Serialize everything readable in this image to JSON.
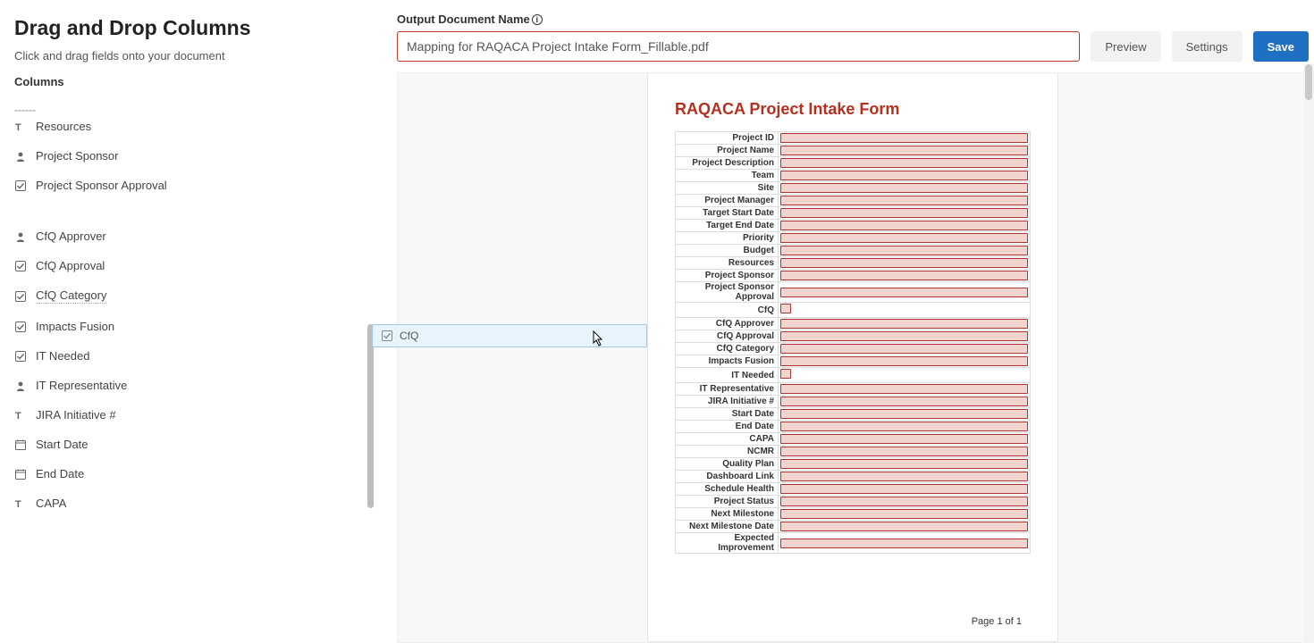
{
  "sidebar": {
    "title": "Drag and Drop Columns",
    "subtitle": "Click and drag fields onto your document",
    "columns_heading": "Columns",
    "partial_top": "------",
    "items": [
      {
        "icon": "text",
        "label": "Resources"
      },
      {
        "icon": "person",
        "label": "Project Sponsor"
      },
      {
        "icon": "checkbox",
        "label": "Project Sponsor Approval"
      },
      {
        "icon": "",
        "label": ""
      },
      {
        "icon": "person",
        "label": "CfQ Approver"
      },
      {
        "icon": "checkbox",
        "label": "CfQ Approval"
      },
      {
        "icon": "checkbox",
        "label": "CfQ Category",
        "dotted": true
      },
      {
        "icon": "checkbox",
        "label": "Impacts Fusion"
      },
      {
        "icon": "checkbox",
        "label": "IT Needed"
      },
      {
        "icon": "person",
        "label": "IT Representative"
      },
      {
        "icon": "text",
        "label": "JIRA Initiative #"
      },
      {
        "icon": "date",
        "label": "Start Date"
      },
      {
        "icon": "date",
        "label": "End Date"
      },
      {
        "icon": "text",
        "label": "CAPA"
      }
    ]
  },
  "top": {
    "odn_label": "Output Document Name",
    "odn_value": "Mapping for RAQACA Project Intake Form_Fillable.pdf",
    "preview": "Preview",
    "settings": "Settings",
    "save": "Save"
  },
  "drag": {
    "label": "CfQ"
  },
  "doc": {
    "title": "RAQACA Project Intake Form",
    "page_num": "Page 1 of 1",
    "rows": [
      {
        "label": "Project ID",
        "type": "field"
      },
      {
        "label": "Project Name",
        "type": "field"
      },
      {
        "label": "Project Description",
        "type": "field"
      },
      {
        "label": "Team",
        "type": "field"
      },
      {
        "label": "Site",
        "type": "field"
      },
      {
        "label": "Project Manager",
        "type": "field"
      },
      {
        "label": "Target Start Date",
        "type": "field"
      },
      {
        "label": "Target End Date",
        "type": "field"
      },
      {
        "label": "Priority",
        "type": "field"
      },
      {
        "label": "Budget",
        "type": "field"
      },
      {
        "label": "Resources",
        "type": "field"
      },
      {
        "label": "Project Sponsor",
        "type": "field"
      },
      {
        "label": "Project Sponsor Approval",
        "type": "field"
      },
      {
        "label": "CfQ",
        "type": "check"
      },
      {
        "label": "CfQ Approver",
        "type": "field"
      },
      {
        "label": "CfQ Approval",
        "type": "field"
      },
      {
        "label": "CfQ Category",
        "type": "field"
      },
      {
        "label": "Impacts Fusion",
        "type": "field"
      },
      {
        "label": "IT Needed",
        "type": "check"
      },
      {
        "label": "IT Representative",
        "type": "field"
      },
      {
        "label": "JIRA Initiative #",
        "type": "field"
      },
      {
        "label": "Start Date",
        "type": "field"
      },
      {
        "label": "End Date",
        "type": "field"
      },
      {
        "label": "CAPA",
        "type": "field"
      },
      {
        "label": "NCMR",
        "type": "field"
      },
      {
        "label": "Quality Plan",
        "type": "field"
      },
      {
        "label": "Dashboard Link",
        "type": "field"
      },
      {
        "label": "Schedule Health",
        "type": "field"
      },
      {
        "label": "Project Status",
        "type": "field"
      },
      {
        "label": "Next Milestone",
        "type": "field"
      },
      {
        "label": "Next Milestone Date",
        "type": "field"
      },
      {
        "label": "Expected Improvement",
        "type": "field"
      }
    ]
  }
}
